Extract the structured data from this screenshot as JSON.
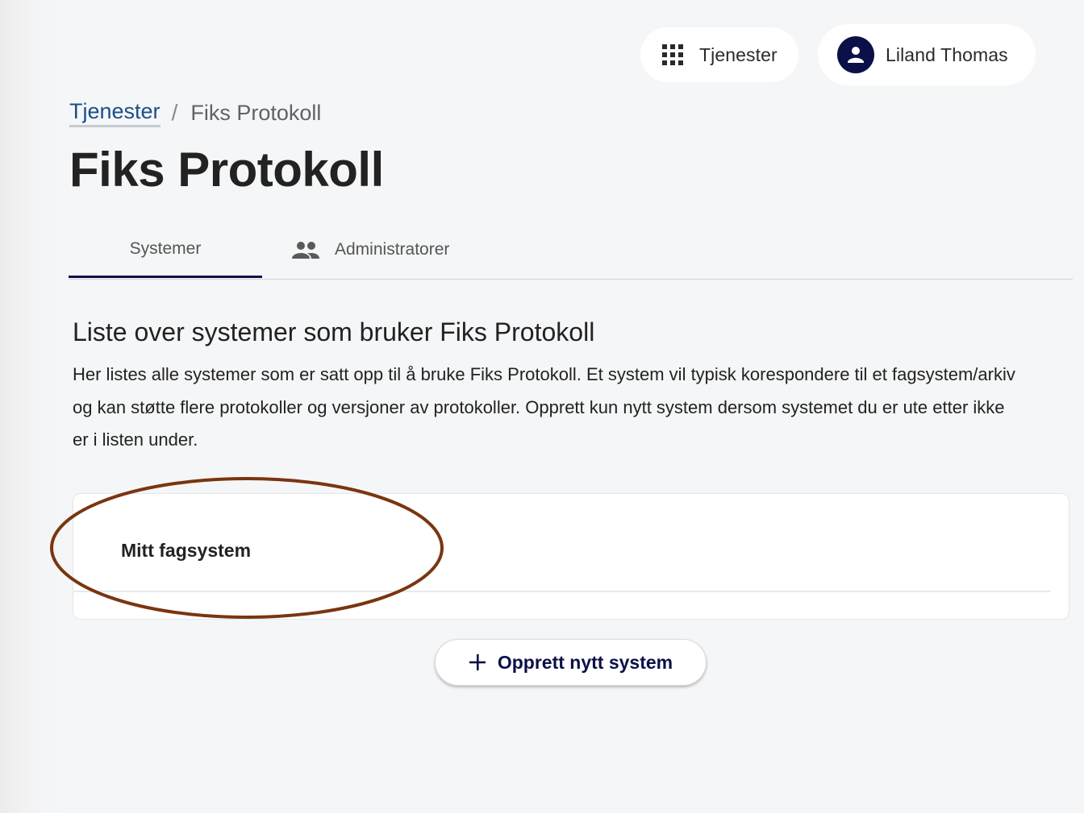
{
  "header": {
    "services_label": "Tjenester",
    "user_name": "Liland Thomas"
  },
  "breadcrumb": {
    "parent": "Tjenester",
    "separator": "/",
    "current": "Fiks Protokoll"
  },
  "page": {
    "title": "Fiks Protokoll"
  },
  "tabs": [
    {
      "label": "Systemer",
      "active": true
    },
    {
      "label": "Administratorer",
      "active": false,
      "icon": "people-icon"
    }
  ],
  "section": {
    "heading": "Liste over systemer som bruker Fiks Protokoll",
    "description": "Her listes alle systemer som er satt opp til å bruke Fiks Protokoll. Et system vil typisk korespondere til et fagsystem/arkiv og kan støtte flere protokoller og versjoner av protokoller. Opprett kun nytt system dersom systemet du er ute etter ikke er i listen under."
  },
  "systems": [
    {
      "name": "Mitt fagsystem"
    }
  ],
  "actions": {
    "create_label": "Opprett nytt system"
  },
  "colors": {
    "accent": "#0b1048",
    "link": "#1a4f8a",
    "highlight": "#7a3510",
    "background": "#f5f6f7"
  }
}
